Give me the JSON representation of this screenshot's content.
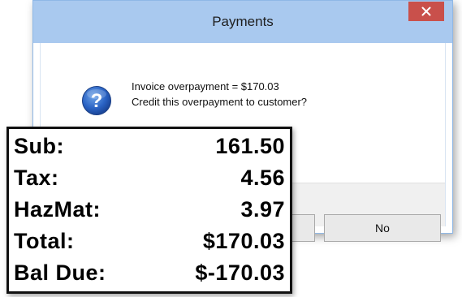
{
  "dialog": {
    "title": "Payments",
    "message_line1": "Invoice overpayment = $170.03",
    "message_line2": "Credit this overpayment to customer?",
    "no_label": "No",
    "yes_label": ""
  },
  "totals": {
    "rows": [
      {
        "label": "Sub:",
        "value": "161.50"
      },
      {
        "label": "Tax:",
        "value": "4.56"
      },
      {
        "label": "HazMat:",
        "value": "3.97"
      },
      {
        "label": "Total:",
        "value": "$170.03"
      },
      {
        "label": "Bal Due:",
        "value": "$-170.03"
      }
    ]
  },
  "colors": {
    "titlebar": "#a9c9ef",
    "close_button": "#c9504b",
    "button_strip": "#f0f0f0"
  },
  "icons": {
    "close": "close-icon",
    "question": "question-icon"
  }
}
